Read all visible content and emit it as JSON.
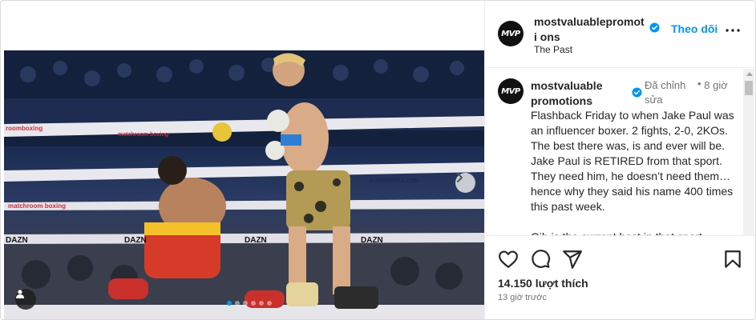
{
  "post": {
    "account": "mostvaluablepromotions",
    "account_header_wrapped": "mostvaluablepromoti ons",
    "avatar_text": "MVP",
    "follow_label": "Theo dõi",
    "subtitle": "The Past",
    "caption_user": "mostvaluablepromotions",
    "edited_label": "Đã chỉnh sửa",
    "separator": "•",
    "relative_time": "8 giờ",
    "caption_text": "Flashback Friday to when Jake Paul was an influencer boxer. 2 fights, 2-0, 2KOs. The best there was, is and ever will be. Jake Paul is RETIRED from that sport. They need him, he doesn’t need them… hence why they said his name 400 times this past week.\n\nGib is the current best in that sport.",
    "likes": "14.150 lượt thích",
    "posted_ago": "13 giờ trước"
  },
  "carousel": {
    "total_slides": 6,
    "active_slide": 1
  },
  "photo_text": {
    "matchroom_1": "matchroom boxing",
    "matchroom_2": "matchroom boxing",
    "jdsports": "@JDSPORTS.COM",
    "dazn_1": "DAZN",
    "dazn_2": "DAZN",
    "dazn_3": "DAZN",
    "dazn_4": "DAZN",
    "boxing_left": "roomboxing"
  },
  "icons": {
    "like": "heart-icon",
    "comment": "comment-icon",
    "share": "share-icon",
    "save": "bookmark-icon",
    "more": "more-options-icon",
    "next": "chevron-right-icon",
    "tag": "user-tag-icon",
    "verified": "verified-badge-icon"
  },
  "colors": {
    "accent": "#0095f6",
    "text": "#262626",
    "muted": "#737373"
  }
}
